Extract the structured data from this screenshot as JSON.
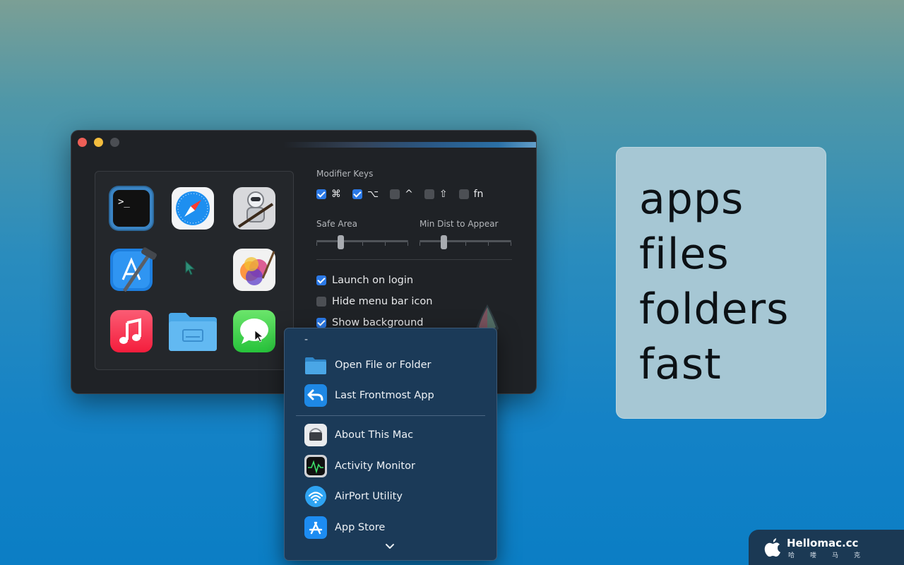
{
  "window": {
    "modifier_keys_label": "Modifier Keys",
    "modifiers": [
      {
        "symbol": "⌘",
        "checked": true
      },
      {
        "symbol": "⌥",
        "checked": true
      },
      {
        "symbol": "^",
        "checked": false
      },
      {
        "symbol": "⇧",
        "checked": false
      },
      {
        "symbol": "fn",
        "checked": false
      }
    ],
    "safe_area_label": "Safe Area",
    "safe_area_value": 0.25,
    "min_dist_label": "Min Dist to Appear",
    "min_dist_value": 0.25,
    "options": [
      {
        "label": "Launch on login",
        "checked": true
      },
      {
        "label": "Hide menu bar icon",
        "checked": false
      },
      {
        "label": "Show background",
        "checked": true
      }
    ],
    "grid_apps": [
      "terminal-icon",
      "safari-icon",
      "automator-icon",
      "xcode-icon",
      "cursor-icon",
      "pixelmator-icon",
      "music-icon",
      "folder-icon",
      "messages-icon"
    ]
  },
  "menu": {
    "dash": "-",
    "items": [
      {
        "label": "Open File or Folder",
        "icon": "folder-icon"
      },
      {
        "label": "Last Frontmost App",
        "icon": "return-arrow-icon"
      },
      {
        "label": "About This Mac",
        "icon": "about-mac-icon"
      },
      {
        "label": "Activity Monitor",
        "icon": "activity-monitor-icon"
      },
      {
        "label": "AirPort Utility",
        "icon": "airport-utility-icon"
      },
      {
        "label": "App Store",
        "icon": "app-store-icon"
      }
    ]
  },
  "card": {
    "words": [
      "apps",
      "files",
      "folders",
      "fast"
    ]
  },
  "watermark": {
    "title": "Hellomac.cc",
    "subtitle": "哈喽马克"
  },
  "colors": {
    "accent": "#2b79e6",
    "menu_bg": "#1b3a58",
    "card_bg": "#a6c7d4"
  }
}
